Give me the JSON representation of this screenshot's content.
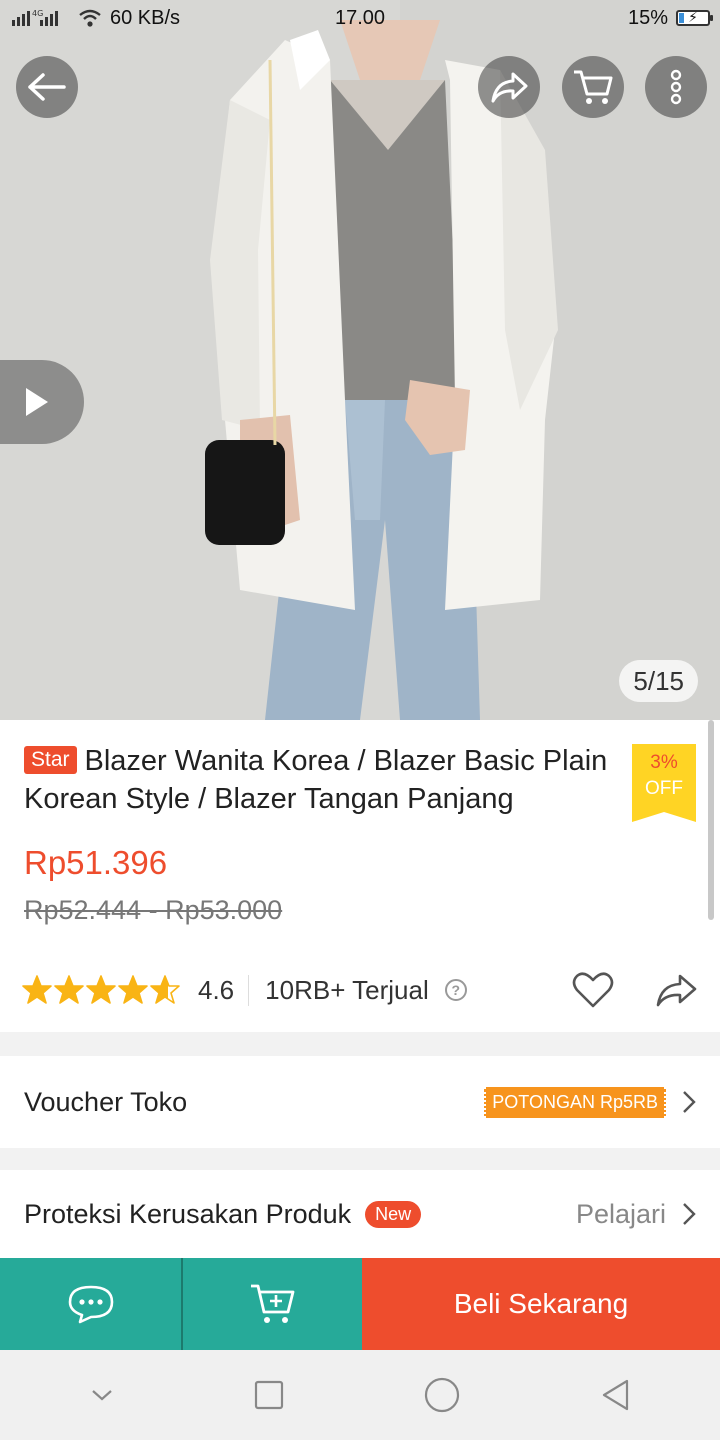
{
  "status_bar": {
    "network": "4G",
    "speed": "60 KB/s",
    "time": "17.00",
    "battery": "15%",
    "battery_level": 0.15
  },
  "gallery": {
    "counter": "5/15",
    "current": 5,
    "total": 15
  },
  "product": {
    "badge": "Star",
    "title": "Blazer Wanita Korea / Blazer Basic Plain Korean Style / Blazer Tangan Panjang",
    "discount_pct": "3%",
    "discount_word": "OFF",
    "price": "Rp51.396",
    "original_price": "Rp52.444 - Rp53.000",
    "rating": "4.6",
    "rating_value": 4.6,
    "sold": "10RB+ Terjual",
    "help_symbol": "?"
  },
  "voucher": {
    "label": "Voucher Toko",
    "tag": "POTONGAN Rp5RB"
  },
  "protection": {
    "label": "Proteksi Kerusakan Produk",
    "badge": "New",
    "link": "Pelajari"
  },
  "bottom_bar": {
    "buy_label": "Beli Sekarang"
  },
  "colors": {
    "brand": "#ee4d2d",
    "teal": "#26aa99",
    "star": "#f9b415",
    "voucher": "#f7941d",
    "discount": "#ffd424"
  }
}
